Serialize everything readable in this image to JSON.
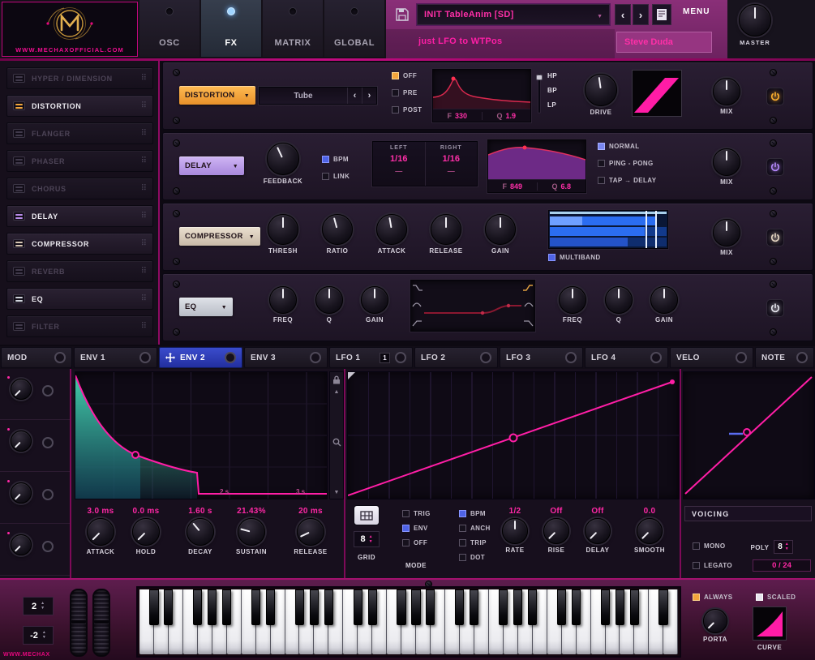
{
  "colors": {
    "accent_magenta": "#ff28a6",
    "orange": "#f2a53c",
    "purple": "#a888dc",
    "tan": "#c8baa8",
    "gray": "#b8bcc6",
    "blue": "#4f63e6",
    "meter_green": "#35d455"
  },
  "header": {
    "logo_text": "WWW.MECHAXOFFICIAL.COM",
    "tabs": [
      {
        "label": "OSC",
        "active": false
      },
      {
        "label": "FX",
        "active": true
      },
      {
        "label": "MATRIX",
        "active": false
      },
      {
        "label": "GLOBAL",
        "active": false
      }
    ],
    "preset_name": "INIT TableAnim [SD]",
    "preset_subtitle": "just LFO to WTPos",
    "preset_author": "Steve Duda",
    "menu_label": "MENU",
    "master_label": "MASTER",
    "prev_label": "‹",
    "next_label": "›"
  },
  "fx_list": [
    {
      "label": "HYPER / DIMENSION",
      "enabled": false
    },
    {
      "label": "DISTORTION",
      "enabled": true
    },
    {
      "label": "FLANGER",
      "enabled": false
    },
    {
      "label": "PHASER",
      "enabled": false
    },
    {
      "label": "CHORUS",
      "enabled": false
    },
    {
      "label": "DELAY",
      "enabled": true
    },
    {
      "label": "COMPRESSOR",
      "enabled": true
    },
    {
      "label": "REVERB",
      "enabled": false
    },
    {
      "label": "EQ",
      "enabled": true
    },
    {
      "label": "FILTER",
      "enabled": false
    }
  ],
  "distortion": {
    "title": "DISTORTION",
    "type_value": "Tube",
    "route_off": "OFF",
    "route_pre": "PRE",
    "route_post": "POST",
    "freq_label": "F",
    "freq_value": "330",
    "q_label": "Q",
    "q_value": "1.9",
    "filter_hp": "HP",
    "filter_bp": "BP",
    "filter_lp": "LP",
    "drive_label": "DRIVE",
    "mix_label": "MIX"
  },
  "delay": {
    "title": "DELAY",
    "feedback_label": "FEEDBACK",
    "bpm_label": "BPM",
    "link_label": "LINK",
    "left_label": "LEFT",
    "right_label": "RIGHT",
    "left_value": "1/16",
    "right_value": "1/16",
    "left_ms": "—",
    "right_ms": "—",
    "freq_label": "F",
    "freq_value": "849",
    "q_label": "Q",
    "q_value": "6.8",
    "mode_normal": "NORMAL",
    "mode_pingpong": "PING - PONG",
    "mode_tap": "TAP → DELAY",
    "mix_label": "MIX"
  },
  "compressor": {
    "title": "COMPRESSOR",
    "knobs": [
      {
        "label": "THRESH"
      },
      {
        "label": "RATIO"
      },
      {
        "label": "ATTACK"
      },
      {
        "label": "RELEASE"
      },
      {
        "label": "GAIN"
      }
    ],
    "multiband_label": "MULTIBAND",
    "mix_label": "MIX"
  },
  "eq": {
    "title": "EQ",
    "left_knobs": [
      {
        "label": "FREQ"
      },
      {
        "label": "Q"
      },
      {
        "label": "GAIN"
      }
    ],
    "right_knobs": [
      {
        "label": "FREQ"
      },
      {
        "label": "Q"
      },
      {
        "label": "GAIN"
      }
    ]
  },
  "mod_tabs": [
    {
      "label": "MOD"
    },
    {
      "label": "ENV 1"
    },
    {
      "label": "ENV 2",
      "active": true
    },
    {
      "label": "ENV 3"
    },
    {
      "label": "LFO 1",
      "badge": "1"
    },
    {
      "label": "LFO 2"
    },
    {
      "label": "LFO 3"
    },
    {
      "label": "LFO 4"
    },
    {
      "label": "VELO"
    },
    {
      "label": "NOTE"
    }
  ],
  "envelope": {
    "knobs": [
      {
        "value": "3.0 ms",
        "label": "ATTACK"
      },
      {
        "value": "0.0 ms",
        "label": "HOLD"
      },
      {
        "value": "1.60 s",
        "label": "DECAY"
      },
      {
        "value": "21.43%",
        "label": "SUSTAIN"
      },
      {
        "value": "20 ms",
        "label": "RELEASE"
      }
    ],
    "time_label_2s": "2 s",
    "time_label_3s": "3 s"
  },
  "lfo": {
    "grid_value": "8",
    "grid_label": "GRID",
    "mode_label": "MODE",
    "check_trig": "TRIG",
    "check_env": "ENV",
    "check_off": "OFF",
    "check_bpm": "BPM",
    "check_anch": "ANCH",
    "check_trip": "TRIP",
    "check_dot": "DOT",
    "knobs": [
      {
        "value": "1/2",
        "label": "RATE"
      },
      {
        "value": "Off",
        "label": "RISE"
      },
      {
        "value": "Off",
        "label": "DELAY"
      },
      {
        "value": "0.0",
        "label": "SMOOTH"
      }
    ]
  },
  "voicing": {
    "title": "VOICING",
    "mono_label": "MONO",
    "poly_label": "POLY",
    "poly_value": "8",
    "legato_label": "LEGATO",
    "counter_value": "0 / 24"
  },
  "keyboard": {
    "octave_up_value": "2",
    "octave_down_value": "-2",
    "always_label": "ALWAYS",
    "scaled_label": "SCALED",
    "porta_label": "PORTA",
    "curve_label": "CURVE",
    "corner_text": "WWW.MECHAXOFFICIAL.COM"
  }
}
